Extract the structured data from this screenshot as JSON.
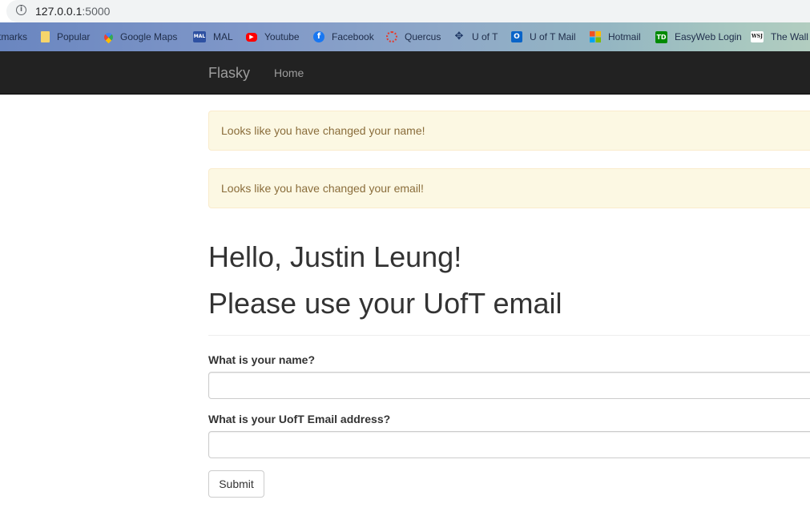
{
  "browser": {
    "url_host": "127.0.0.1",
    "url_port": ":5000",
    "info_glyph": "i"
  },
  "bookmarks": [
    {
      "label": "tmarks",
      "icon": "none"
    },
    {
      "label": "Popular",
      "icon": "folder-icon",
      "color": "#f6d56b"
    },
    {
      "label": "Google Maps",
      "icon": "google-maps-icon",
      "color": "#34a853"
    },
    {
      "label": "MAL",
      "icon": "mal-icon",
      "color": "#2e51a2",
      "glyph": "MAL"
    },
    {
      "label": "Youtube",
      "icon": "youtube-icon",
      "color": "#ff0000",
      "glyph": "▶"
    },
    {
      "label": "Facebook",
      "icon": "facebook-icon",
      "color": "#1877f2",
      "glyph": "f"
    },
    {
      "label": "Quercus",
      "icon": "quercus-icon",
      "color": "#e23b2e"
    },
    {
      "label": "U of T",
      "icon": "uoft-icon",
      "color": "#1e3765"
    },
    {
      "label": "U of T Mail",
      "icon": "outlook-icon",
      "color": "#0a64c8",
      "glyph": "O"
    },
    {
      "label": "Hotmail",
      "icon": "microsoft-icon",
      "color": "#f25022"
    },
    {
      "label": "EasyWeb Login",
      "icon": "td-icon",
      "color": "#008a00",
      "glyph": "TD"
    },
    {
      "label": "The Wall",
      "icon": "wsj-icon",
      "color": "#ffffff",
      "glyph": "WSJ"
    }
  ],
  "navbar": {
    "brand": "Flasky",
    "home": "Home"
  },
  "alerts": [
    "Looks like you have changed your name!",
    "Looks like you have changed your email!"
  ],
  "main": {
    "greeting": "Hello, Justin Leung!",
    "subheading": "Please use your UofT email",
    "name_label": "What is your name?",
    "name_value": "",
    "email_label": "What is your UofT Email address?",
    "email_value": "",
    "submit_label": "Submit"
  }
}
